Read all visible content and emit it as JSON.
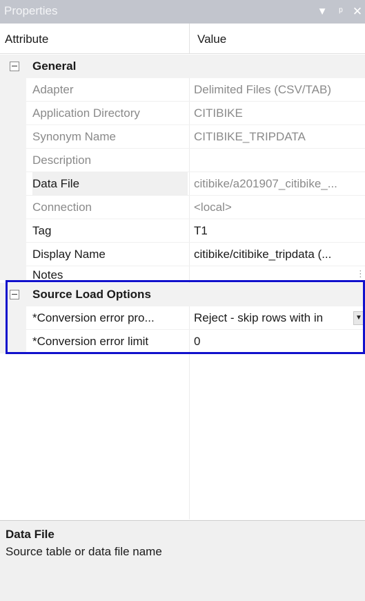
{
  "panel": {
    "title": "Properties",
    "dropdown_icon": "caret-down-icon",
    "pin_icon": "pin-icon",
    "close_icon": "close-icon"
  },
  "columns": {
    "attribute": "Attribute",
    "value": "Value"
  },
  "categories": [
    {
      "label": "General",
      "rows": [
        {
          "name": "Adapter",
          "value": "Delimited Files (CSV/TAB)",
          "readonly": true
        },
        {
          "name": "Application Directory",
          "value": "CITIBIKE",
          "readonly": true
        },
        {
          "name": "Synonym Name",
          "value": "CITIBIKE_TRIPDATA",
          "readonly": true
        },
        {
          "name": "Description",
          "value": "",
          "readonly": true
        },
        {
          "name": "Data File",
          "value": "citibike/a201907_citibike_...",
          "readonly": true,
          "selected": true
        },
        {
          "name": "Connection",
          "value": "<local>",
          "readonly": true
        },
        {
          "name": "Tag",
          "value": "T1",
          "readonly": false
        },
        {
          "name": "Display Name",
          "value": "citibike/citibike_tripdata (...",
          "readonly": false
        },
        {
          "name": "Notes",
          "value": "",
          "readonly": false
        }
      ]
    },
    {
      "label": "Source Load Options",
      "rows": [
        {
          "name": "*Conversion error pro...",
          "value": "Reject - skip rows with in",
          "readonly": false,
          "dropdown": true
        },
        {
          "name": "*Conversion error limit",
          "value": "0",
          "readonly": false
        }
      ]
    }
  ],
  "description": {
    "title": "Data File",
    "text": "Source table or data file name"
  },
  "colors": {
    "titlebar": "#c2c5cd",
    "highlight": "#1111cc",
    "category_bg": "#f2f2f2"
  }
}
